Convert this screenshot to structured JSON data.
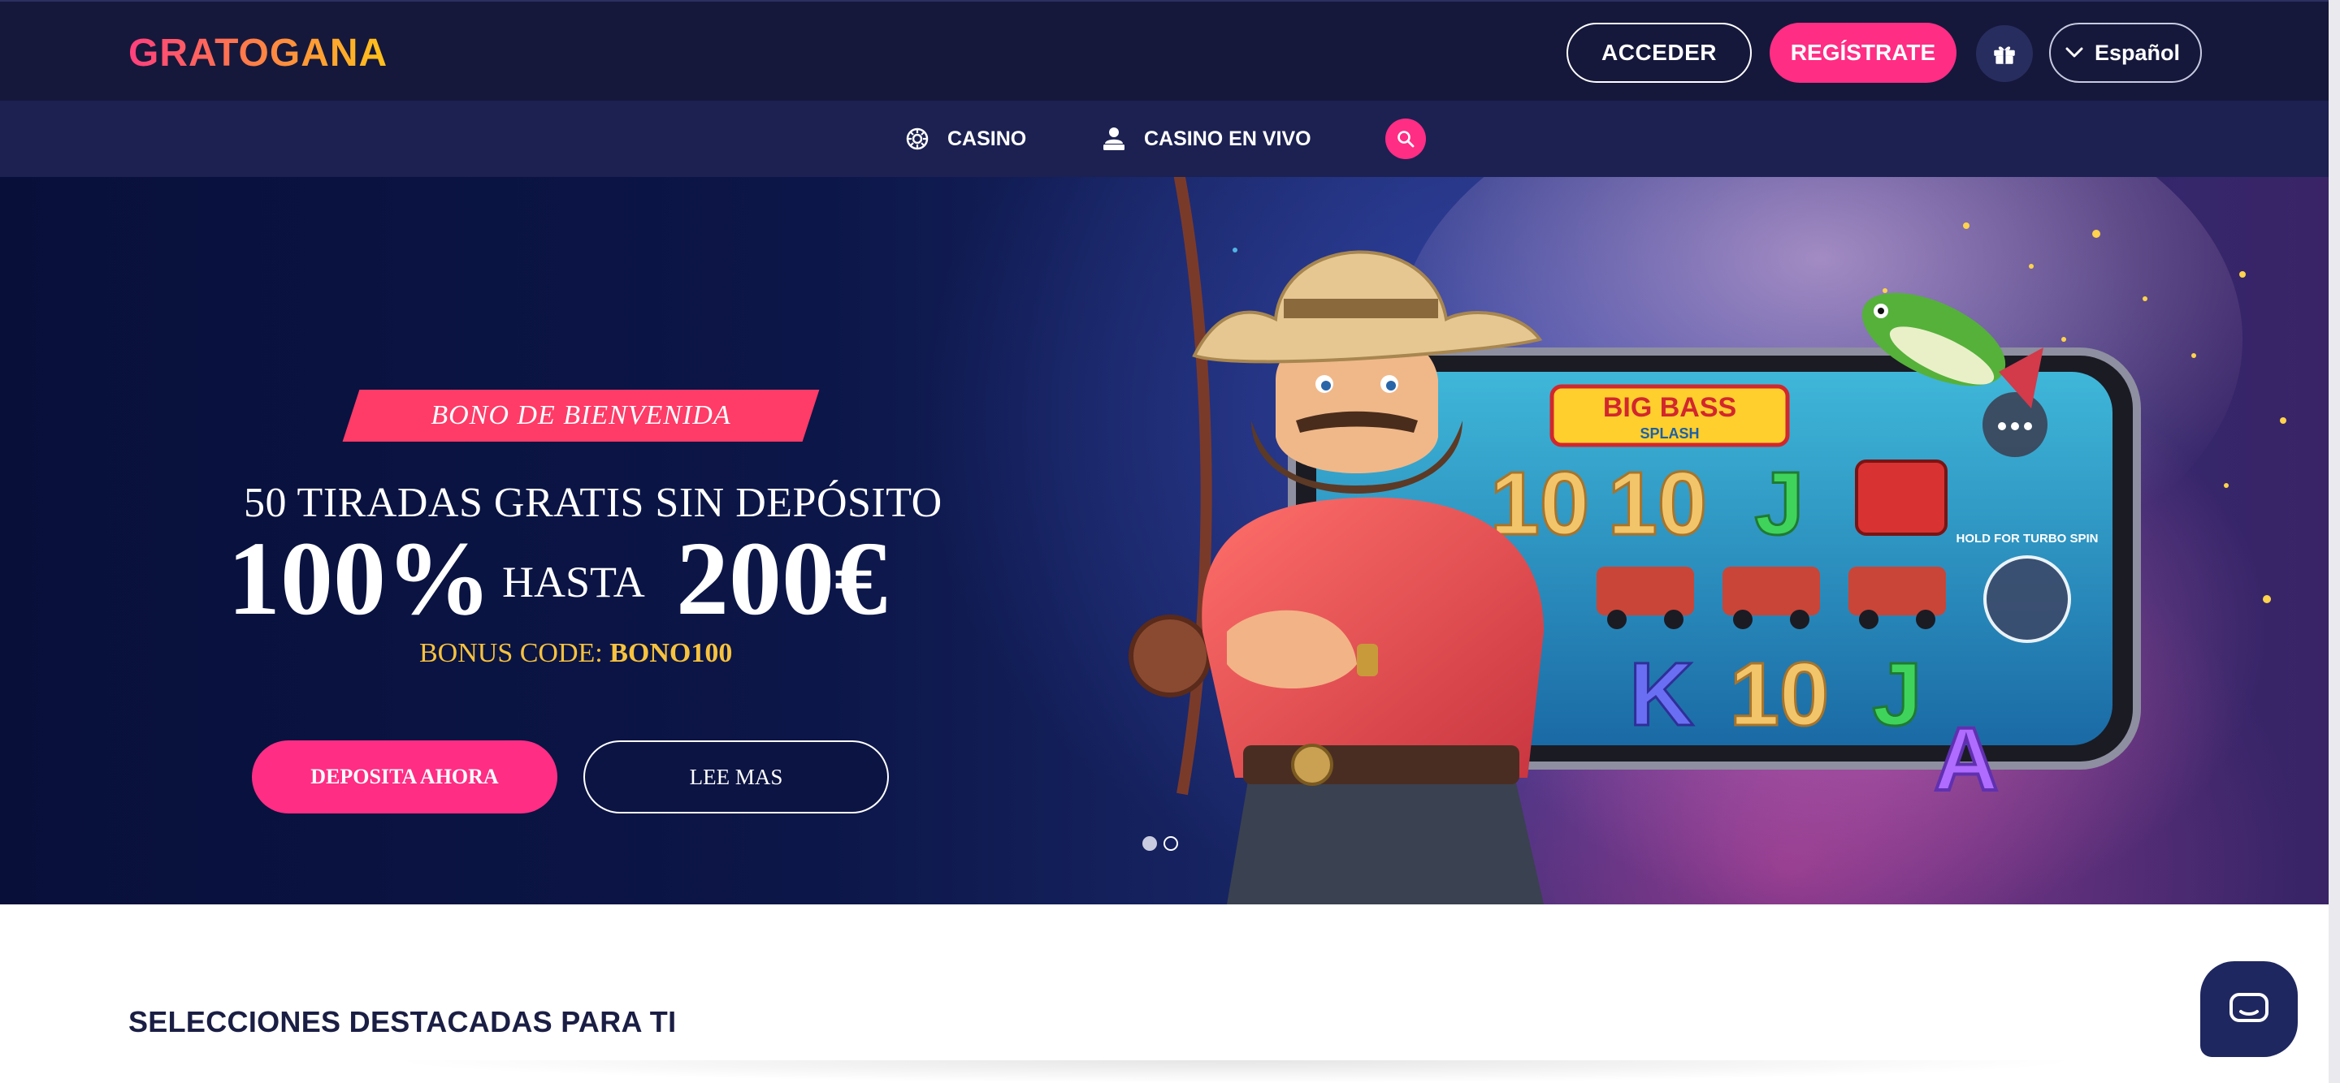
{
  "header": {
    "logo": "GRATOGANA",
    "login_label": "ACCEDER",
    "register_label": "REGÍSTRATE",
    "gift_icon": "gift-icon",
    "language": "Español"
  },
  "nav": {
    "items": [
      {
        "label": "CASINO",
        "icon": "roulette-icon"
      },
      {
        "label": "CASINO EN VIVO",
        "icon": "live-dealer-icon"
      }
    ],
    "search_icon": "search-icon"
  },
  "hero": {
    "ribbon": "BONO DE BIENVENIDA",
    "headline": "50 TIRADAS GRATIS SIN DEPÓSITO",
    "percent": "100%",
    "hasta": "HASTA",
    "amount": "200€",
    "bonus_code_label": "BONUS CODE:",
    "bonus_code": "BONO100",
    "deposit_label": "DEPOSITA AHORA",
    "more_label": "LEE MAS",
    "slide_count": 2,
    "active_slide": 1,
    "art": {
      "game_title": "BIG BASS",
      "game_subtitle": "SPLASH",
      "turbo_label": "HOLD FOR TURBO SPIN",
      "reel_symbols": [
        "10",
        "10",
        "J",
        "K",
        "10",
        "J",
        "A"
      ]
    }
  },
  "main": {
    "section_title": "SELECCIONES DESTACADAS PARA TI"
  },
  "colors": {
    "header_bg": "#15183b",
    "nav_bg": "#1c2152",
    "accent_pink": "#ff2d84",
    "ribbon_red": "#ff3b67",
    "bonus_gold": "#f7c23d",
    "title_dark": "#1b1e44"
  },
  "chat": {
    "icon": "chat-bubble-icon"
  }
}
